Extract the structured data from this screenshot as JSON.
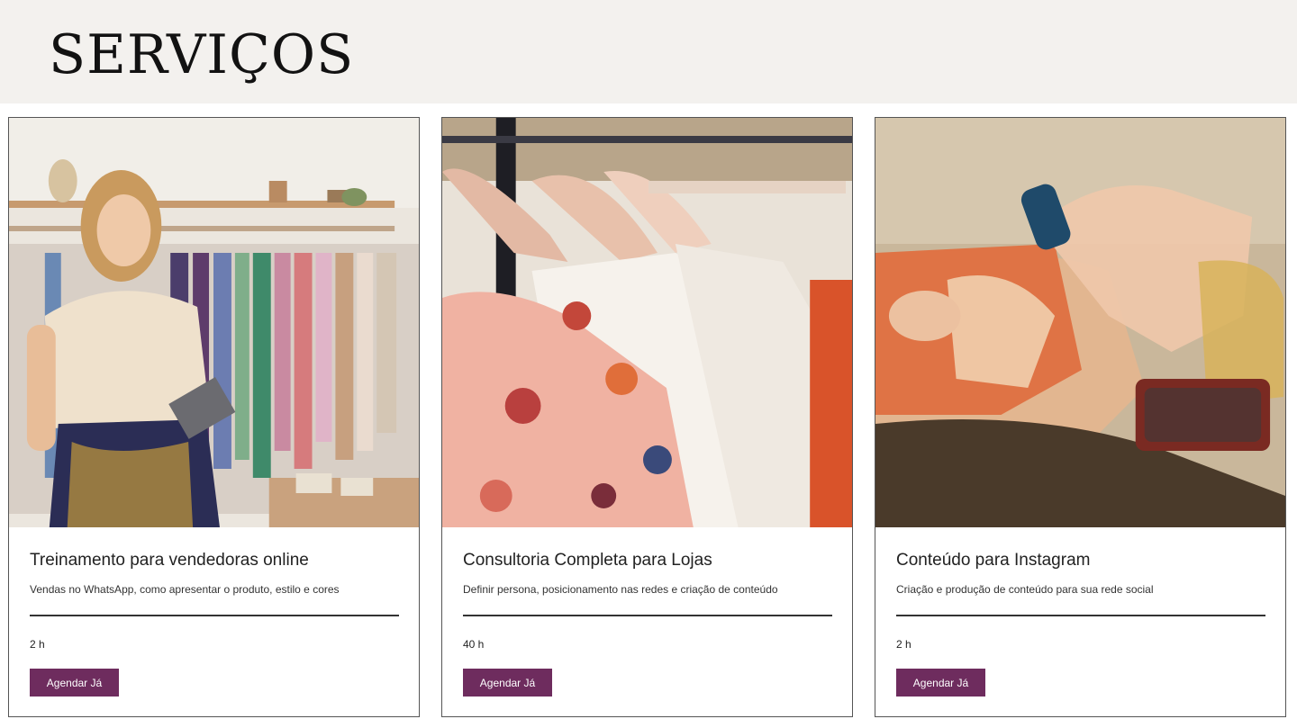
{
  "header": {
    "title": "SERVIÇOS"
  },
  "services": [
    {
      "image_alt": "boutique-saleswoman-photo",
      "title": "Treinamento para vendedoras online",
      "description": "Vendas no WhatsApp, como apresentar o produto, estilo e cores",
      "duration": "2 h",
      "button_label": "Agendar Já"
    },
    {
      "image_alt": "clothes-on-hangers-photo",
      "title": "Consultoria Completa para Lojas",
      "description": "Definir persona, posicionamento nas redes e criação de conteúdo",
      "duration": "40 h",
      "button_label": "Agendar Já"
    },
    {
      "image_alt": "beach-swimsuit-photo",
      "title": "Conteúdo para Instagram",
      "description": "Criação e produção de conteúdo para sua rede social",
      "duration": "2 h",
      "button_label": "Agendar Já"
    }
  ],
  "colors": {
    "header_bg": "#f3f1ee",
    "button_bg": "#6e2c5e",
    "button_text": "#ffffff"
  }
}
